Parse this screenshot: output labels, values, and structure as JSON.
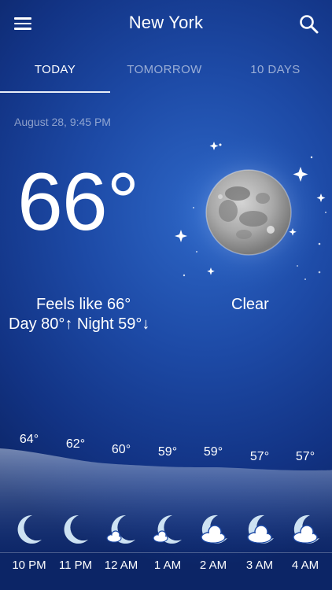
{
  "header": {
    "city": "New York",
    "menu_icon": "hamburger-menu-icon",
    "search_icon": "search-icon"
  },
  "tabs": [
    {
      "label": "TODAY",
      "active": true
    },
    {
      "label": "TOMORROW",
      "active": false
    },
    {
      "label": "10 DAYS",
      "active": false
    }
  ],
  "current": {
    "datetime": "August 28, 9:45 PM",
    "temperature": "66°",
    "feels_like": "Feels like 66°",
    "day_night": "Day 80°↑  Night 59°↓",
    "condition": "Clear",
    "condition_icon": "full-moon-icon"
  },
  "hourly": [
    {
      "time": "10 PM",
      "temp": "64°",
      "icon": "crescent-moon-icon"
    },
    {
      "time": "11 PM",
      "temp": "62°",
      "icon": "crescent-moon-icon"
    },
    {
      "time": "12 AM",
      "temp": "60°",
      "icon": "moon-small-cloud-icon"
    },
    {
      "time": "1 AM",
      "temp": "59°",
      "icon": "moon-small-cloud-icon"
    },
    {
      "time": "2 AM",
      "temp": "59°",
      "icon": "moon-cloud-icon"
    },
    {
      "time": "3 AM",
      "temp": "57°",
      "icon": "moon-cloud-icon"
    },
    {
      "time": "4 AM",
      "temp": "57°",
      "icon": "moon-cloud-icon"
    }
  ],
  "colors": {
    "background_top": "#2d66c6",
    "background_bottom": "#0c2566",
    "curve_fill": "#bfcde4",
    "moon_icon": "#cde2f2"
  }
}
